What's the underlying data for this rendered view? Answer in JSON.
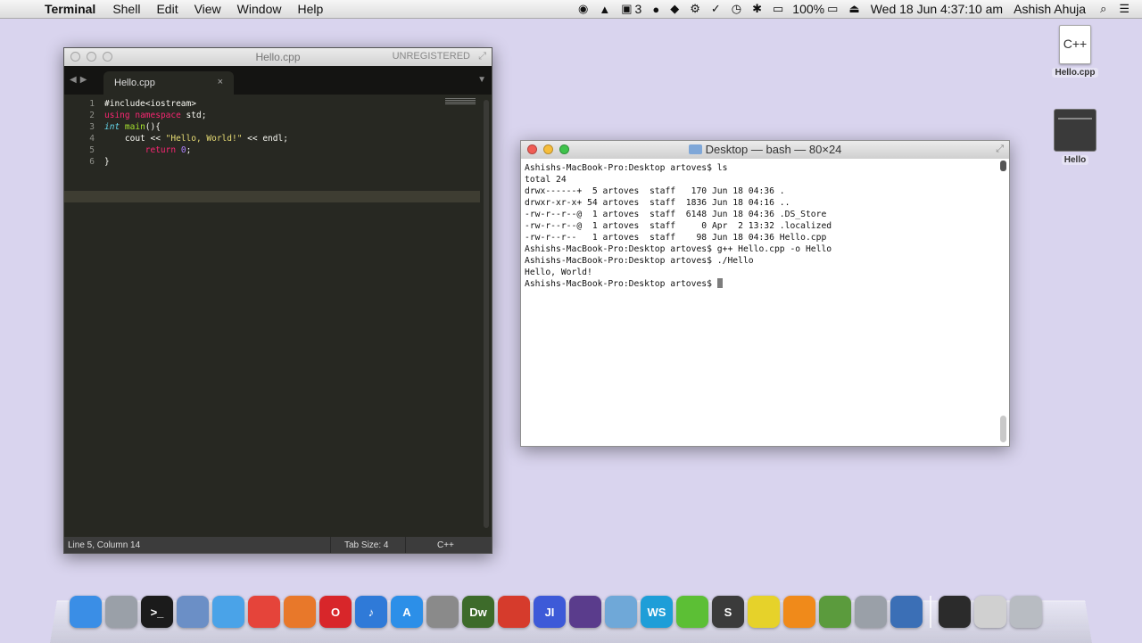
{
  "menubar": {
    "app_name": "Terminal",
    "items": [
      "Shell",
      "Edit",
      "View",
      "Window",
      "Help"
    ],
    "status": {
      "indicator_count": "3",
      "battery": "100%",
      "datetime": "Wed 18 Jun  4:37:10 am",
      "user": "Ashish Ahuja"
    }
  },
  "sublime": {
    "title": "Hello.cpp",
    "unregistered": "UNREGISTERED",
    "tab_label": "Hello.cpp",
    "line_numbers": [
      "1",
      "2",
      "3",
      "4",
      "5",
      "6"
    ],
    "code": {
      "line1": "#include<iostream>",
      "line2_kw": "using",
      "line2_kw2": "namespace",
      "line2_rest": " std;",
      "line3_type": "int",
      "line3_fn": "main",
      "line3_rest": "(){",
      "line4_pre": "    cout << ",
      "line4_str": "\"Hello, World!\"",
      "line4_post": " << endl;",
      "line5_kw": "return",
      "line5_num": "0",
      "line5_post": ";",
      "line6": "}"
    },
    "status": {
      "position": "Line 5, Column 14",
      "tab_size": "Tab Size: 4",
      "syntax": "C++"
    }
  },
  "terminal": {
    "title": "Desktop — bash — 80×24",
    "lines": [
      "Ashishs-MacBook-Pro:Desktop artoves$ ls",
      "total 24",
      "drwx------+  5 artoves  staff   170 Jun 18 04:36 .",
      "drwxr-xr-x+ 54 artoves  staff  1836 Jun 18 04:16 ..",
      "-rw-r--r--@  1 artoves  staff  6148 Jun 18 04:36 .DS_Store",
      "-rw-r--r--@  1 artoves  staff     0 Apr  2 13:32 .localized",
      "-rw-r--r--   1 artoves  staff    98 Jun 18 04:36 Hello.cpp",
      "Ashishs-MacBook-Pro:Desktop artoves$ g++ Hello.cpp -o Hello",
      "Ashishs-MacBook-Pro:Desktop artoves$ ./Hello",
      "Hello, World!"
    ],
    "prompt": "Ashishs-MacBook-Pro:Desktop artoves$ "
  },
  "desktop": {
    "icons": [
      {
        "label": "Hello.cpp",
        "glyph": "C++"
      },
      {
        "label": "Hello"
      }
    ]
  },
  "dock": {
    "items": [
      {
        "name": "finder",
        "label": "",
        "color": "#3a8ee6"
      },
      {
        "name": "launchpad",
        "label": "",
        "color": "#9aa0a8"
      },
      {
        "name": "terminal",
        "label": ">_",
        "color": "#1b1b1b"
      },
      {
        "name": "preview",
        "label": "",
        "color": "#6b8fc6"
      },
      {
        "name": "safari",
        "label": "",
        "color": "#4aa3e8"
      },
      {
        "name": "chrome",
        "label": "",
        "color": "#e5443a"
      },
      {
        "name": "firefox",
        "label": "",
        "color": "#e8782a"
      },
      {
        "name": "opera",
        "label": "O",
        "color": "#d8262a"
      },
      {
        "name": "itunes",
        "label": "♪",
        "color": "#2f7ad8"
      },
      {
        "name": "app-store",
        "label": "A",
        "color": "#2c8fe8"
      },
      {
        "name": "system-utility",
        "label": "",
        "color": "#8a8a8a"
      },
      {
        "name": "dreamweaver",
        "label": "Dw",
        "color": "#3d6b2a"
      },
      {
        "name": "microsoft-office",
        "label": "",
        "color": "#d63b2c"
      },
      {
        "name": "intellij",
        "label": "JI",
        "color": "#3d5ad8"
      },
      {
        "name": "eclipse",
        "label": "",
        "color": "#5a3c8c"
      },
      {
        "name": "virtualbox",
        "label": "",
        "color": "#6fa8d8"
      },
      {
        "name": "webstorm",
        "label": "WS",
        "color": "#1e9ed8"
      },
      {
        "name": "evernote-leaf",
        "label": "",
        "color": "#5cbf35"
      },
      {
        "name": "sublime-text",
        "label": "S",
        "color": "#3b3b3b"
      },
      {
        "name": "notes-yellow",
        "label": "",
        "color": "#e6d22a"
      },
      {
        "name": "vlc",
        "label": "",
        "color": "#f08a1a"
      },
      {
        "name": "android-sdk",
        "label": "",
        "color": "#5b9b3d"
      },
      {
        "name": "settings",
        "label": "",
        "color": "#9aa0a8"
      },
      {
        "name": "magnifier",
        "label": "",
        "color": "#3b6fb6"
      },
      {
        "name": "folder",
        "label": "",
        "color": "#2b2b2b"
      },
      {
        "name": "actions",
        "label": "",
        "color": "#d0d0d0"
      },
      {
        "name": "trash",
        "label": "",
        "color": "#b8bcc2"
      }
    ]
  }
}
